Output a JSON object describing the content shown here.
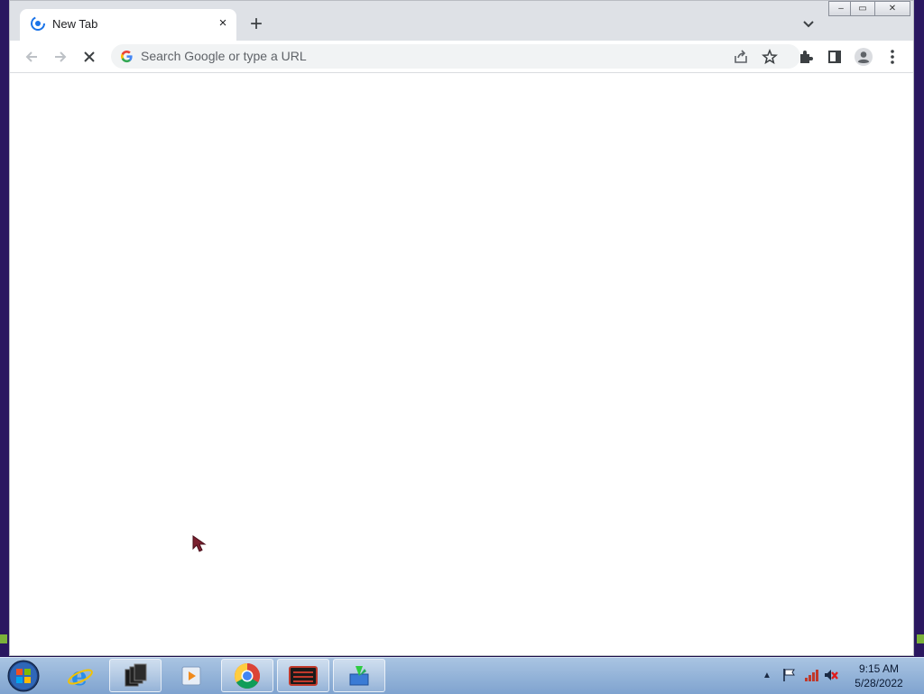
{
  "browser": {
    "tab": {
      "title": "New Tab",
      "favicon": "chromium-icon",
      "close": "×"
    },
    "new_tab_symbol": "+",
    "window_controls": {
      "minimize": "–",
      "maximize": "▭",
      "close": "✕"
    },
    "omnibox": {
      "placeholder": "Search Google or type a URL",
      "icon": "google-g-icon"
    },
    "toolbar_icons": [
      "back-icon",
      "forward-icon",
      "stop-loading-icon",
      "share-icon",
      "bookmark-star-icon",
      "extensions-icon",
      "side-panel-icon",
      "profile-icon",
      "menu-icon"
    ]
  },
  "taskbar": {
    "apps": [
      "internet-explorer-icon",
      "window-stack-icon",
      "media-player-icon",
      "chrome-icon",
      "terminal-icon",
      "installer-icon"
    ],
    "tray_icons": [
      "show-hidden-icons",
      "action-center-flag-icon",
      "network-icon",
      "volume-muted-icon"
    ],
    "clock": {
      "time": "9:15 AM",
      "date": "5/28/2022"
    }
  },
  "colors": {
    "accent": "#1a73e8",
    "desktop": "#1c0f4a",
    "taskbar": "#8eaed6"
  }
}
